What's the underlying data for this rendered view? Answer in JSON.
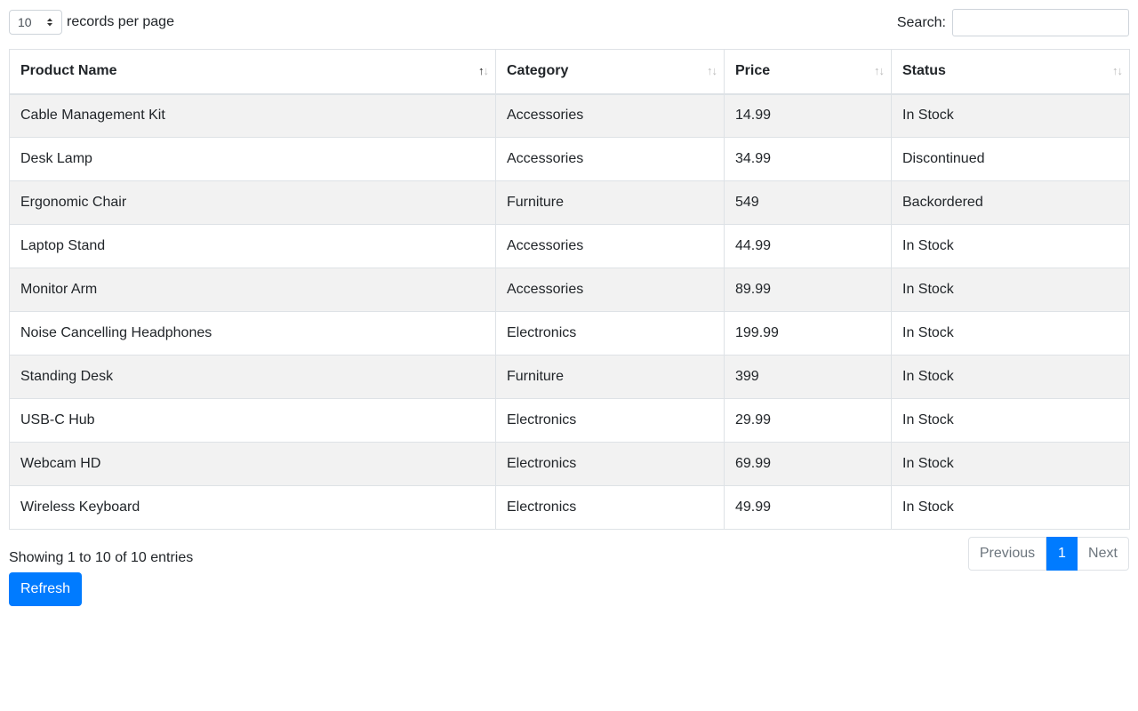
{
  "length_control": {
    "selected": "10",
    "label": "records per page",
    "arrows_icon": "select-arrows-icon"
  },
  "search": {
    "label": "Search:",
    "value": "",
    "placeholder": ""
  },
  "table": {
    "columns": [
      {
        "label": "Product Name",
        "sort": "ascending"
      },
      {
        "label": "Category",
        "sort": "none"
      },
      {
        "label": "Price",
        "sort": "none"
      },
      {
        "label": "Status",
        "sort": "none"
      }
    ],
    "rows": [
      [
        "Cable Management Kit",
        "Accessories",
        "14.99",
        "In Stock"
      ],
      [
        "Desk Lamp",
        "Accessories",
        "34.99",
        "Discontinued"
      ],
      [
        "Ergonomic Chair",
        "Furniture",
        "549",
        "Backordered"
      ],
      [
        "Laptop Stand",
        "Accessories",
        "44.99",
        "In Stock"
      ],
      [
        "Monitor Arm",
        "Accessories",
        "89.99",
        "In Stock"
      ],
      [
        "Noise Cancelling Headphones",
        "Electronics",
        "199.99",
        "In Stock"
      ],
      [
        "Standing Desk",
        "Furniture",
        "399",
        "In Stock"
      ],
      [
        "USB-C Hub",
        "Electronics",
        "29.99",
        "In Stock"
      ],
      [
        "Webcam HD",
        "Electronics",
        "69.99",
        "In Stock"
      ],
      [
        "Wireless Keyboard",
        "Electronics",
        "49.99",
        "In Stock"
      ]
    ]
  },
  "footer": {
    "info": "Showing 1 to 10 of 10 entries",
    "pagination": {
      "previous": "Previous",
      "current": "1",
      "next": "Next"
    }
  },
  "refresh_label": "Refresh",
  "colors": {
    "accent": "#007bff",
    "stripe": "#f2f2f2",
    "border": "#dee2e6"
  }
}
